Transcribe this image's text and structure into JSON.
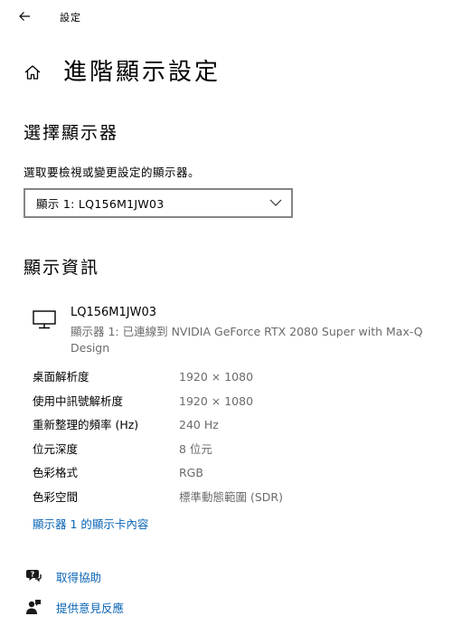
{
  "window": {
    "title": "設定",
    "back_icon": "back-arrow-icon"
  },
  "header": {
    "home_icon": "home-icon",
    "title": "進階顯示設定"
  },
  "select_display": {
    "heading": "選擇顯示器",
    "label": "選取要檢視或變更設定的顯示器。",
    "selected": "顯示 1: LQ156M1JW03"
  },
  "display_info": {
    "heading": "顯示資訊",
    "monitor_name": "LQ156M1JW03",
    "monitor_desc": "顯示器 1: 已連線到 NVIDIA GeForce RTX 2080 Super with Max-Q Design",
    "rows": [
      {
        "key": "桌面解析度",
        "value": "1920 × 1080"
      },
      {
        "key": "使用中訊號解析度",
        "value": "1920 × 1080"
      },
      {
        "key": "重新整理的頻率 (Hz)",
        "value": "240 Hz"
      },
      {
        "key": "位元深度",
        "value": "8 位元"
      },
      {
        "key": "色彩格式",
        "value": "RGB"
      },
      {
        "key": "色彩空間",
        "value": "標準動態範圍 (SDR)"
      }
    ],
    "adapter_link": "顯示器 1 的顯示卡內容"
  },
  "help": {
    "get_help": "取得協助",
    "feedback": "提供意見反應"
  },
  "colors": {
    "link": "#0a64b5",
    "secondary_text": "#6b6b6b",
    "border": "#858585"
  }
}
